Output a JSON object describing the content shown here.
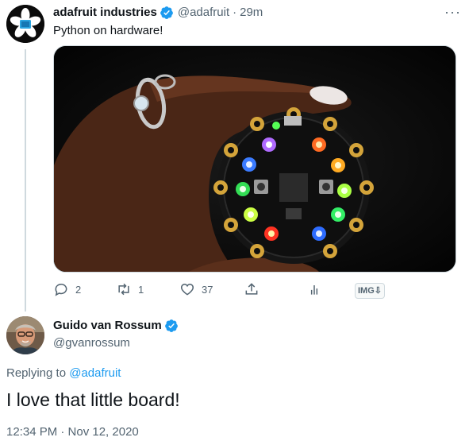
{
  "parent_tweet": {
    "author_name": "adafruit industries",
    "author_handle": "@adafruit",
    "separator": "·",
    "time_ago": "29m",
    "text": "Python on hardware!",
    "more_label": "···",
    "media": {
      "icon": "circuit-board-photo"
    },
    "actions": {
      "reply_count": "2",
      "retweet_count": "1",
      "like_count": "37",
      "img_label": "IMG⇩"
    }
  },
  "reply_tweet": {
    "author_name": "Guido van Rossum",
    "author_handle": "@gvanrossum",
    "replying_prefix": "Replying to",
    "replying_to": "@adafruit",
    "text": "I love that little board!",
    "timestamp": "12:34 PM · Nov 12, 2020"
  },
  "colors": {
    "link": "#1d9bf0",
    "verified": "#1d9bf0",
    "muted": "#536471",
    "divider": "#cfd9de"
  }
}
